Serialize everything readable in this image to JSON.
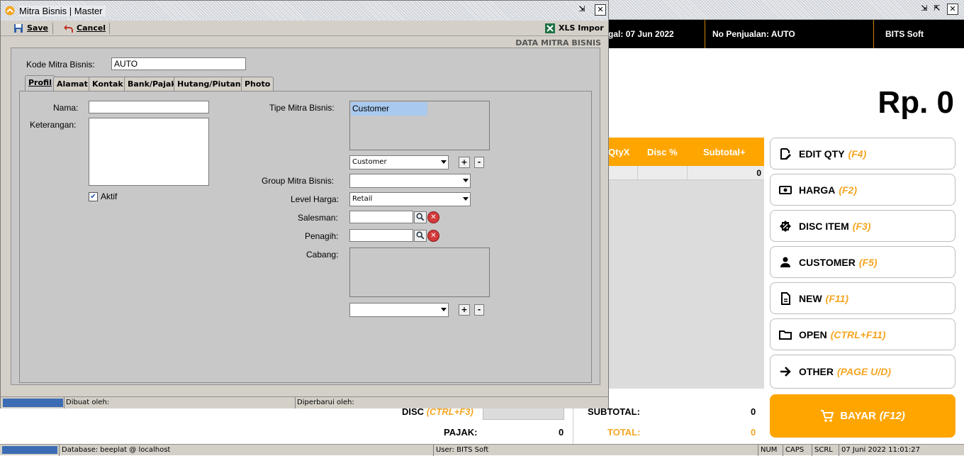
{
  "pos": {
    "tanggal_label": "gal:",
    "tanggal_value": "07 Jun 2022",
    "no_penjualan_label": "No Penjualan:",
    "no_penjualan_value": "AUTO",
    "brand": "BITS Soft",
    "total_big": "Rp. 0",
    "grid": {
      "columns": [
        "QtyX",
        "Disc %",
        "Subtotal+"
      ],
      "row_value": "0"
    },
    "buttons": [
      {
        "label": "EDIT QTY",
        "key": "(F4)",
        "icon": "edit-icon"
      },
      {
        "label": "HARGA",
        "key": "(F2)",
        "icon": "money-icon"
      },
      {
        "label": "DISC ITEM",
        "key": "(F3)",
        "icon": "discount-icon"
      },
      {
        "label": "CUSTOMER",
        "key": "(F5)",
        "icon": "person-icon"
      },
      {
        "label": "NEW",
        "key": "(F11)",
        "icon": "document-icon"
      },
      {
        "label": "OPEN",
        "key": "(CTRL+F11)",
        "icon": "folder-icon"
      },
      {
        "label": "OTHER",
        "key": "(PAGE U/D)",
        "icon": "arrow-right-icon"
      }
    ],
    "bayar": {
      "label": "BAYAR",
      "key": "(F12)"
    },
    "summary": {
      "disc_label": "DISC",
      "disc_key": "(CTRL+F3)",
      "pajak_label": "PAJAK:",
      "pajak_value": "0",
      "subtotal_label": "SUBTOTAL:",
      "subtotal_value": "0",
      "total_label": "TOTAL:",
      "total_value": "0"
    },
    "status": {
      "database": "Database: beeplat @ localhost",
      "user": "User: BITS Soft",
      "num": "NUM",
      "caps": "CAPS",
      "scrl": "SCRL",
      "datetime": "07 Juni 2022   11:01:27"
    }
  },
  "dialog": {
    "title": "Mitra Bisnis | Master",
    "toolbar": {
      "save": "Save",
      "cancel": "Cancel",
      "xls": "XLS Impor"
    },
    "section_title": "DATA MITRA BISNIS",
    "kode_label": "Kode Mitra Bisnis:",
    "kode_value": "AUTO",
    "tabs": [
      "Profil",
      "Alamat",
      "Kontak",
      "Bank/Pajak",
      "Hutang/Piutang",
      "Photo"
    ],
    "fields": {
      "nama_label": "Nama:",
      "keterangan_label": "Keterangan:",
      "aktif_label": "Aktif",
      "aktif_checked": true,
      "tipe_label": "Tipe Mitra Bisnis:",
      "tipe_list": [
        "Customer"
      ],
      "tipe_combo": "Customer",
      "group_label": "Group Mitra Bisnis:",
      "group_value": "",
      "level_label": "Level Harga:",
      "level_value": "Retail",
      "salesman_label": "Salesman:",
      "penagih_label": "Penagih:",
      "cabang_label": "Cabang:",
      "cabang_combo": ""
    },
    "status": {
      "dibuat": "Dibuat oleh:",
      "diperbarui": "Diperbarui oleh:"
    }
  }
}
